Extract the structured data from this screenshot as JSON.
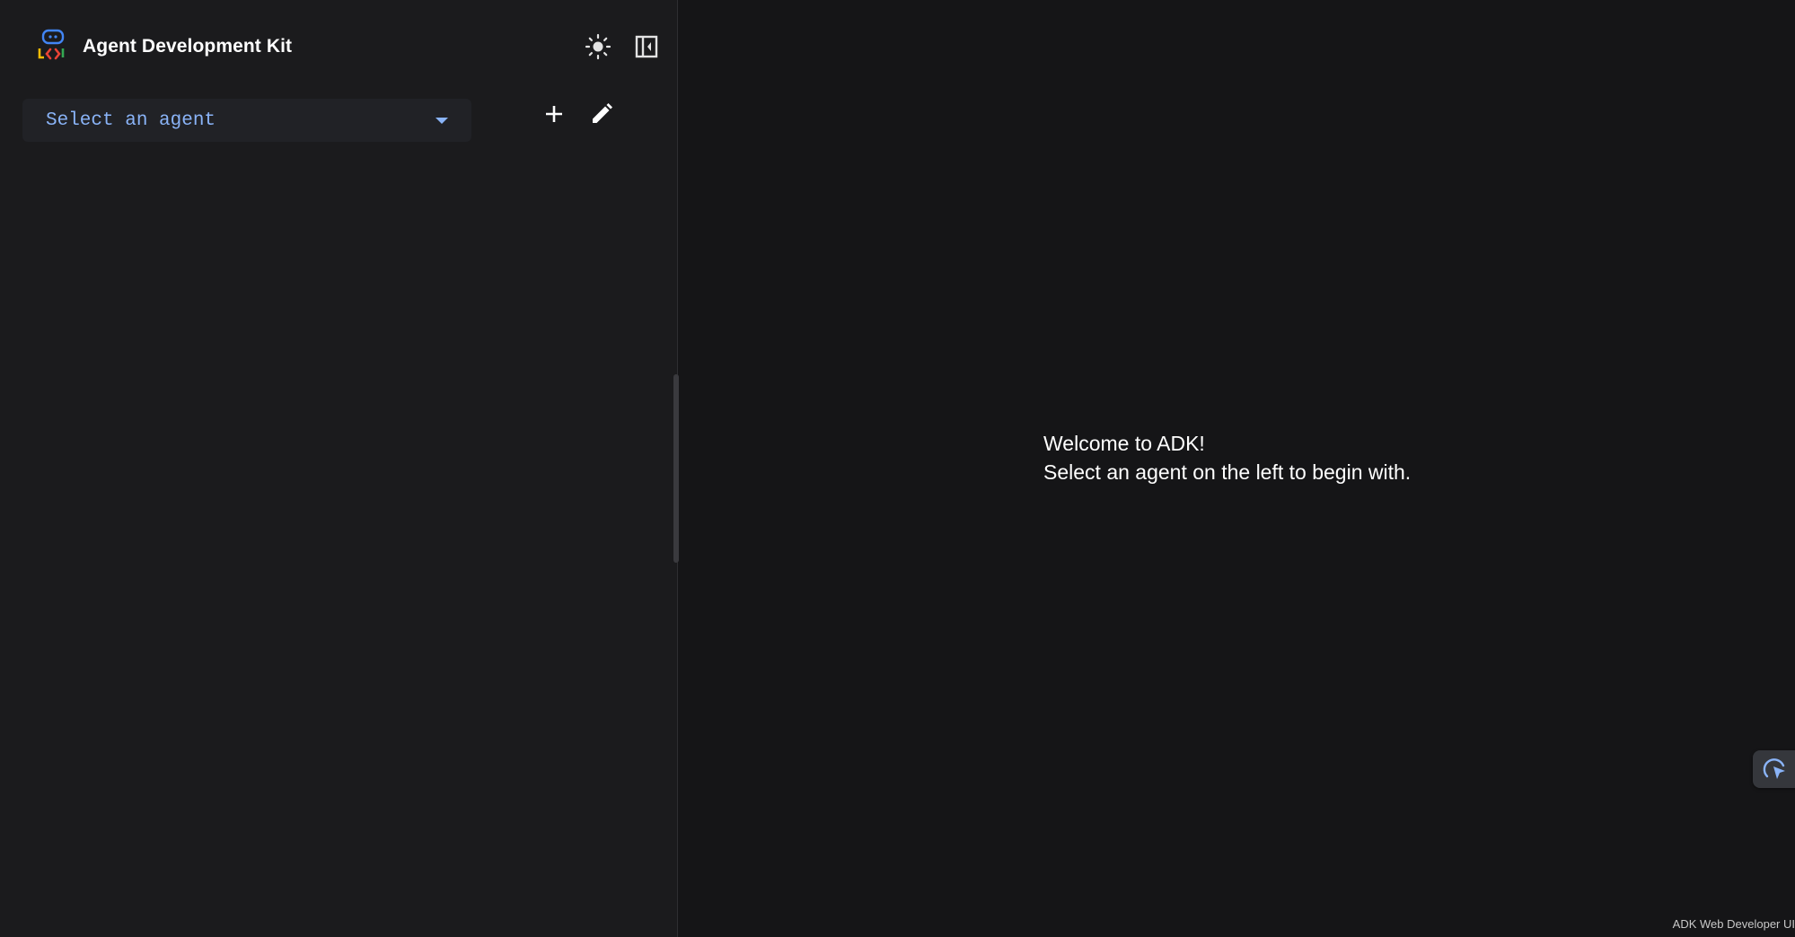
{
  "header": {
    "title": "Agent Development Kit",
    "logo_icon": "adk-logo-icon",
    "theme_toggle_icon": "sun-icon",
    "panel_toggle_icon": "dock-left-icon"
  },
  "agent_selector": {
    "value": "Select an agent",
    "icon": "chevron-down-icon"
  },
  "toolbar": {
    "add_icon": "plus-icon",
    "edit_icon": "pencil-icon"
  },
  "main": {
    "welcome_line1": "Welcome to ADK!",
    "welcome_line2": "Select an agent on the left to begin with."
  },
  "floating_action": {
    "icon": "cursor-select-icon"
  },
  "footer": {
    "label": "ADK Web Developer UI"
  },
  "colors": {
    "sidebar_bg": "#1b1b1d",
    "main_bg": "#151517",
    "select_bg": "#212226",
    "accent_blue": "#8ab4f8",
    "text_primary": "#ffffff"
  }
}
